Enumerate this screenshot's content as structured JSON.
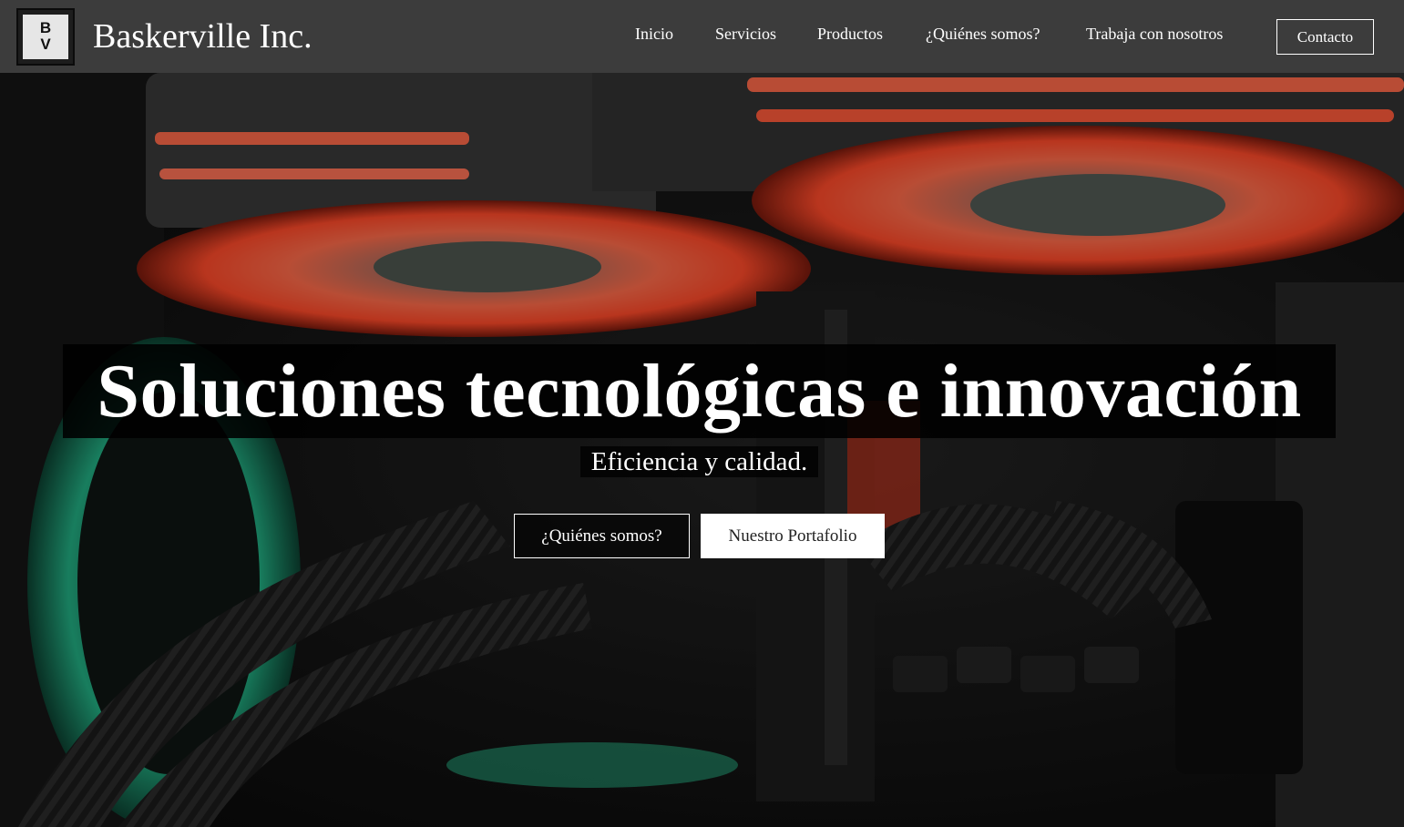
{
  "brand": {
    "logo_letters": [
      "B",
      "V"
    ],
    "name": "Baskerville Inc."
  },
  "nav": {
    "items": [
      "Inicio",
      "Servicios",
      "Productos",
      "¿Quiénes somos?",
      "Trabaja con nosotros"
    ],
    "contact_label": "Contacto"
  },
  "hero": {
    "title": "Soluciones tecnológicas e innovación",
    "subtitle": "Eficiencia y calidad.",
    "primary_button": "¿Quiénes somos?",
    "secondary_button": "Nuestro Portafolio",
    "background": "photo-pc-internals-rgb-fans"
  },
  "colors": {
    "navbar": "#3c3c3c",
    "fan_glow": "#ff5a3a",
    "accent_green": "#2fd9a2"
  }
}
